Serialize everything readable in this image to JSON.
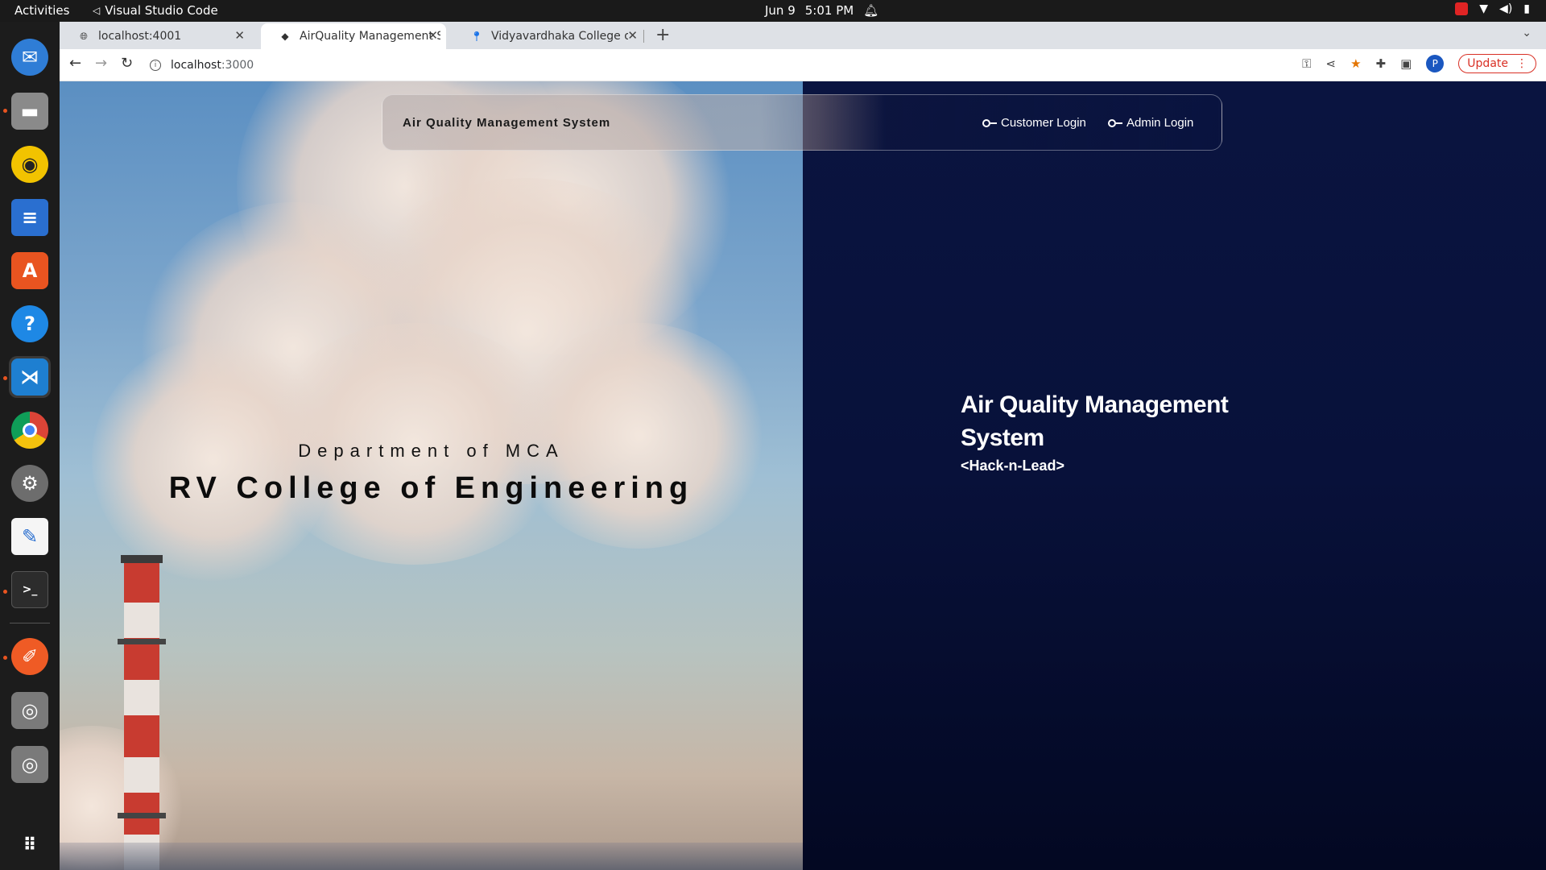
{
  "system": {
    "activities": "Activities",
    "app_name": "Visual Studio Code",
    "date": "Jun 9",
    "time": "5:01 PM"
  },
  "browser": {
    "tabs": [
      {
        "title": "localhost:4001",
        "icon": "globe-icon",
        "active": false
      },
      {
        "title": "AirQuality Management S",
        "icon": "site-favicon",
        "active": true
      },
      {
        "title": "Vidyavardhaka College of",
        "icon": "maps-pin-icon",
        "active": false
      }
    ],
    "url_host": "localhost",
    "url_port": ":3000",
    "update_label": "Update",
    "profile_initial": "P"
  },
  "page": {
    "navbar": {
      "brand": "Air Quality Management System",
      "customer_login": "Customer Login",
      "admin_login": "Admin Login"
    },
    "left": {
      "department": "Department of MCA",
      "college": "RV College of Engineering"
    },
    "hero": {
      "title": "Air Quality Management System",
      "subtitle": "<Hack-n-Lead>"
    }
  },
  "colors": {
    "right_bg": "#0a1440",
    "accent_orange": "#e95420",
    "update_red": "#d93025"
  }
}
